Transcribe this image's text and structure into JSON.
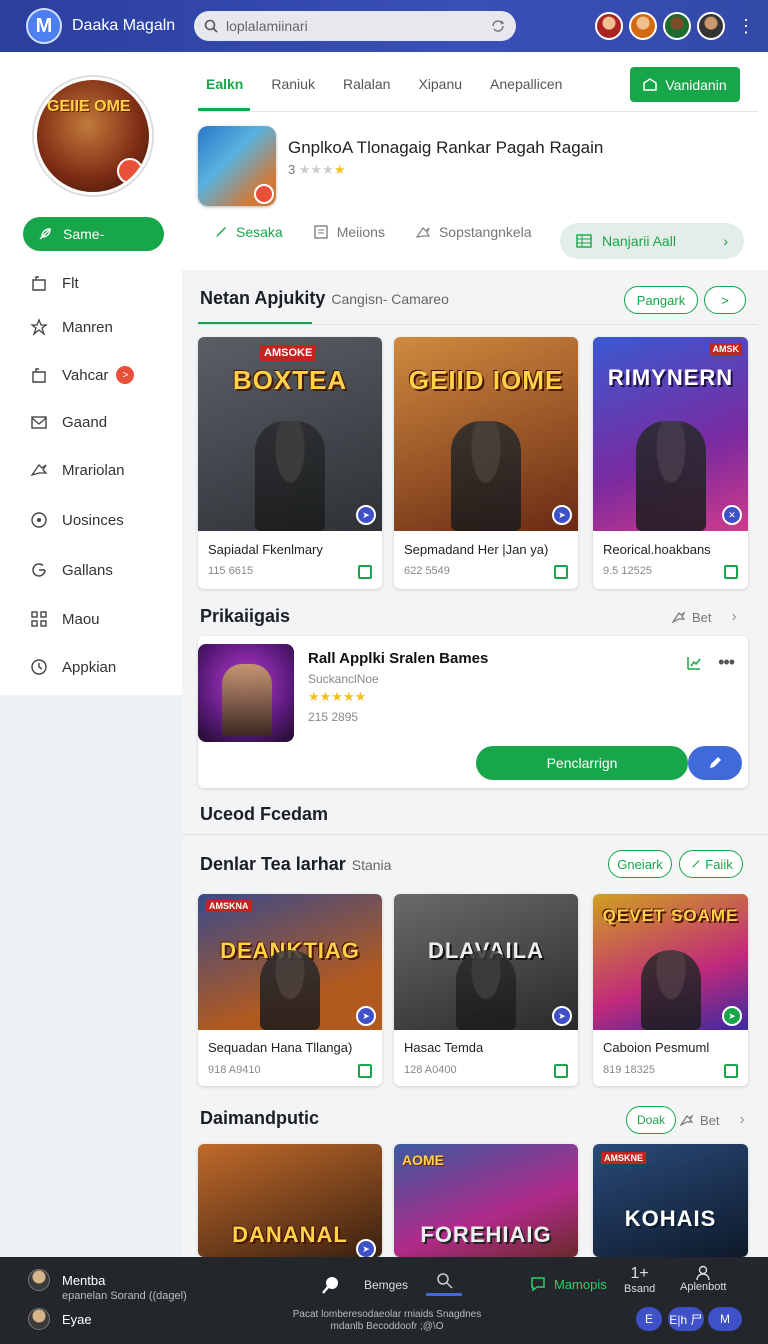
{
  "app": {
    "logo_letter": "M",
    "name": "Daaka Magaln"
  },
  "search": {
    "placeholder": "loplalamiinari"
  },
  "sidebar": {
    "selected": "Same-",
    "items": [
      {
        "label": "Flt",
        "icon": "bag-icon"
      },
      {
        "label": "Manren",
        "icon": "star-icon"
      },
      {
        "label": "Vahcar",
        "icon": "bag-icon",
        "badge": ">"
      },
      {
        "label": "Gaand",
        "icon": "mail-icon"
      },
      {
        "label": "Mrariolan",
        "icon": "share-icon"
      },
      {
        "label": "Uosinces",
        "icon": "target-icon"
      },
      {
        "label": "Gallans",
        "icon": "refresh-icon"
      },
      {
        "label": "Maou",
        "icon": "grid-icon"
      },
      {
        "label": "Appkian",
        "icon": "clock-icon"
      }
    ]
  },
  "header": {
    "tabs": [
      "Ealkn",
      "Raniuk",
      "Ralalan",
      "Xipanu",
      "Anepallicen"
    ],
    "action_label": "Vanidanin",
    "app_title": "GnplkoA Tlonagaig Rankar Pagah Ragain",
    "rating_text": "3",
    "subtabs": [
      {
        "label": "Sesaka",
        "icon": "brush-icon"
      },
      {
        "label": "Meiions",
        "icon": "document-icon"
      },
      {
        "label": "Sopstangnkela",
        "icon": "share-icon"
      }
    ],
    "subtab_pill": "Nanjarii Aall"
  },
  "section1": {
    "title": "Netan Apjukity",
    "subtitle": "Cangisn- Camareo",
    "btn1": "Pangark",
    "btn2": ">",
    "cards": [
      {
        "art_text": "BOXTEA",
        "badge": "AMSOKE",
        "title": "Sapiadal Fkenlmary",
        "stat": "115 6615",
        "bg": "#4b4f57"
      },
      {
        "art_text": "GEIID IOME",
        "badge": "",
        "title": "Sepmadand Her |Jan ya)",
        "stat": "622 5549",
        "bg": "#8a4a22"
      },
      {
        "art_text": "RIMYNERN",
        "badge": "AMSK",
        "title": "Reorical.hoakbans",
        "stat": "9.5 12525",
        "bg": "#6b2d8a"
      }
    ]
  },
  "section2": {
    "title": "Prikaiigais",
    "more_label": "Bet",
    "featured": {
      "title": "Rall Applki Sralen Bames",
      "subtitle": "SuckanclNoe",
      "rating": "★★★★★",
      "stat": "215 2895",
      "primary_btn": "Penclarrign"
    }
  },
  "section3": {
    "title": "Uceod Fcedam"
  },
  "section4": {
    "title": "Denlar Tea larhar",
    "subtitle": "Stania",
    "btn1": "Gneiark",
    "btn2": "Faiik",
    "cards": [
      {
        "art_text": "DEANKTIAG",
        "badge": "AMSKNA",
        "title": "Sequadan Hana Tllanga)",
        "stat": "918 A9410",
        "bg": "#7a4a24"
      },
      {
        "art_text": "DLAVAILA",
        "badge": "",
        "title": "Hasac Temda",
        "stat": "128 A0400",
        "bg": "#4a4a4a"
      },
      {
        "art_text": "QEVET SOAME",
        "badge": "",
        "title": "Caboion Pesmuml",
        "stat": "819 18325",
        "bg": "#b23a6a"
      }
    ]
  },
  "section5": {
    "title": "Daimandputic",
    "btn1": "Doak",
    "more_label": "Bet",
    "cards": [
      {
        "art_text": "DANANAL",
        "badge": "",
        "bg": "#7a4a24"
      },
      {
        "art_text": "FOREHIAIG",
        "badge": "AOME",
        "bg": "#6a2d7a"
      },
      {
        "art_text": "KOHAIS",
        "badge": "AMSKNE",
        "bg": "#1f3a5a"
      }
    ]
  },
  "bottom": {
    "user1": "Mentba",
    "user1_sub": "epanelan Sorand ((dagel)",
    "user2": "Eyae",
    "center1": "Bemges",
    "center_green": "Mamopis",
    "vert1_top": "1+",
    "vert1": "Bsand",
    "vert2": "Aplenbott",
    "footer_text": "Pacat lomberesodaeolar rniaids Snagdnes mdanlb Becoddoofr ;@\\O",
    "btn_a": "E",
    "btn_b": "E|h 尸",
    "btn_c": "M"
  },
  "colors": {
    "accent": "#18a64a",
    "topbar": "#2b3f9e",
    "bottom": "#23272c",
    "blue_btn": "#3f51c8"
  }
}
